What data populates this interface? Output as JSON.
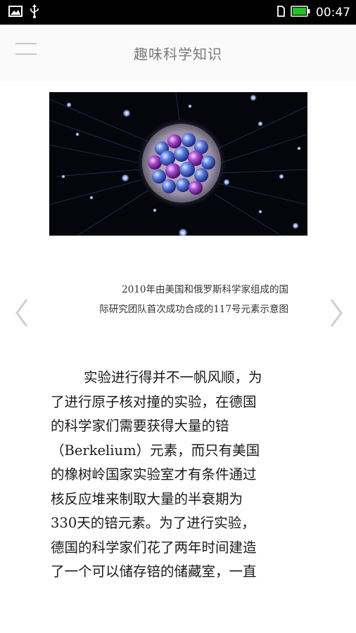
{
  "status_bar": {
    "time": "00:47",
    "icons": [
      "image-icon",
      "usb-icon",
      "sim-icon",
      "battery-icon"
    ],
    "battery_color": "#22c322"
  },
  "header": {
    "title": "趣味科学知识",
    "menu_icon": "hamburger-menu-icon"
  },
  "hero": {
    "description_icon": "atom-nucleus-illustration"
  },
  "caption": {
    "lines": [
      "2010年由美国和俄罗斯科学家组成的国",
      "际研究团队首次成功合成的117号元素示意图"
    ]
  },
  "navigation": {
    "prev_icon": "chevron-left-icon",
    "next_icon": "chevron-right-icon"
  },
  "article": {
    "lines": [
      "实验进行得并不一帆风顺，为",
      "了进行原子核对撞的实验，在德国",
      "的科学家们需要获得大量的锫",
      "（Berkelium）元素，而只有美国",
      "的橡树岭国家实验室才有条件通过",
      "核反应堆来制取大量的半衰期为",
      "330天的锫元素。为了进行实验，",
      "德国的科学家们花了两年时间建造",
      "了一个可以储存锫的储藏室，一直"
    ]
  }
}
